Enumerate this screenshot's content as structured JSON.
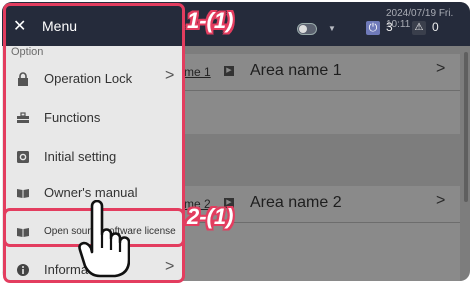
{
  "status_bar": {
    "date": "2024/07/19 Fri. 10:11",
    "power_count": "3",
    "alarm_count": "0"
  },
  "areas": [
    {
      "small_label": "me 1",
      "name": "Area name 1"
    },
    {
      "small_label": "me 2",
      "name": "Area name 2"
    }
  ],
  "menu": {
    "title": "Menu",
    "section": "Option",
    "items": [
      {
        "label": "Operation Lock",
        "icon": "lock-icon",
        "chevron": true
      },
      {
        "label": "Functions",
        "icon": "toolbox-icon",
        "chevron": false
      },
      {
        "label": "Initial setting",
        "icon": "settings-icon",
        "chevron": false
      },
      {
        "label": "Owner's manual",
        "icon": "book-icon",
        "chevron": false
      },
      {
        "label": "Open source software license",
        "icon": "book-icon",
        "chevron": false
      },
      {
        "label": "Information",
        "icon": "info-icon",
        "chevron": true
      }
    ]
  },
  "annotations": {
    "step1": "1-(1)",
    "step2": "2-(1)"
  },
  "colors": {
    "accent": "#e33d5f",
    "topbar": "#252b3b",
    "menu_bg": "#e8e8e8"
  }
}
